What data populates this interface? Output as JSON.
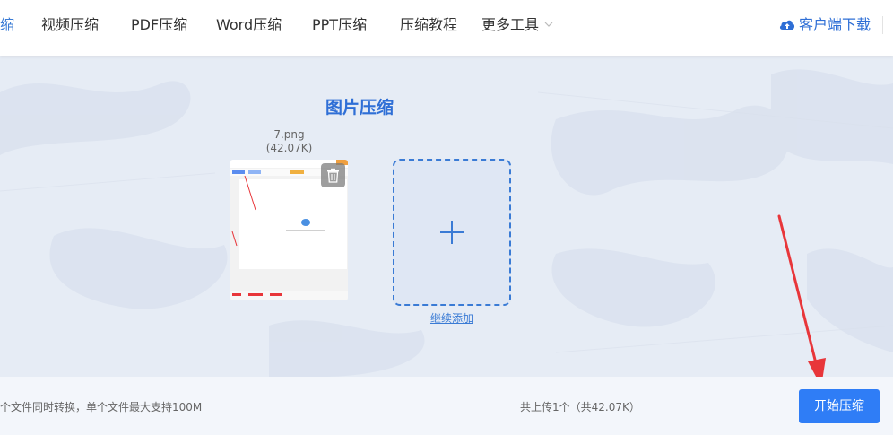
{
  "nav": {
    "items": [
      {
        "label": "缩",
        "active": true
      },
      {
        "label": "视频压缩"
      },
      {
        "label": "PDF压缩"
      },
      {
        "label": "Word压缩"
      },
      {
        "label": "PPT压缩"
      },
      {
        "label": "压缩教程"
      },
      {
        "label": "更多工具"
      }
    ],
    "more_icon": "chevron-down-icon",
    "download_label": "客户端下载",
    "download_icon": "cloud-upload-icon"
  },
  "main": {
    "title": "图片压缩",
    "file": {
      "name": "7.png",
      "size": "(42.07K)",
      "delete_icon": "trash-icon"
    },
    "add_more_label": "继续添加",
    "add_icon": "plus-icon"
  },
  "footer": {
    "hint": "个文件同时转换，单个文件最大支持100M",
    "upload_summary": "共上传1个（共42.07K）",
    "start_button": "开始压缩"
  },
  "colors": {
    "accent": "#2f7df6",
    "title_blue": "#2f6fd6",
    "arrow_red": "#e8363a",
    "background": "#e6ecf5"
  }
}
